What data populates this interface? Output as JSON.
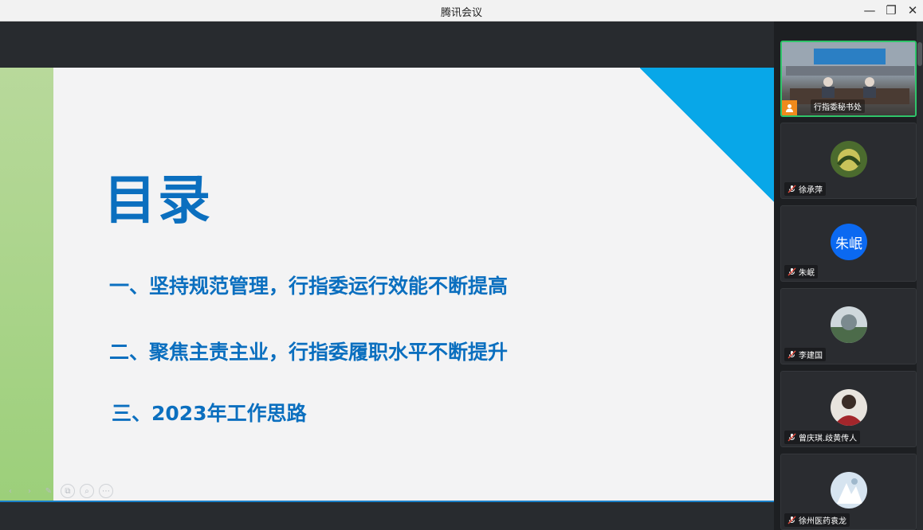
{
  "window": {
    "title": "腾讯会议",
    "controls": {
      "minimize": "—",
      "maximize": "❐",
      "close": "✕"
    }
  },
  "slide": {
    "title": "目录",
    "items": [
      "一、坚持规范管理，行指委运行效能不断提高",
      "二、聚焦主责主业，行指委履职水平不断提升",
      "三、2023年工作思路"
    ],
    "tools": {
      "prev": "‹",
      "next": "›",
      "pen": "✎",
      "copy": "⧉",
      "zoom": "⌕",
      "more": "⋯"
    }
  },
  "participants": [
    {
      "name": "行指委秘书处",
      "type": "video",
      "active": true
    },
    {
      "name": "徐承萍",
      "type": "photo"
    },
    {
      "name": "朱岷",
      "type": "initials",
      "initials": "朱岷",
      "color": "#0b69f1"
    },
    {
      "name": "李建国",
      "type": "photo"
    },
    {
      "name": "曾庆琪.歧黄传人",
      "type": "photo"
    },
    {
      "name": "徐州医药袁龙",
      "type": "photo"
    }
  ]
}
